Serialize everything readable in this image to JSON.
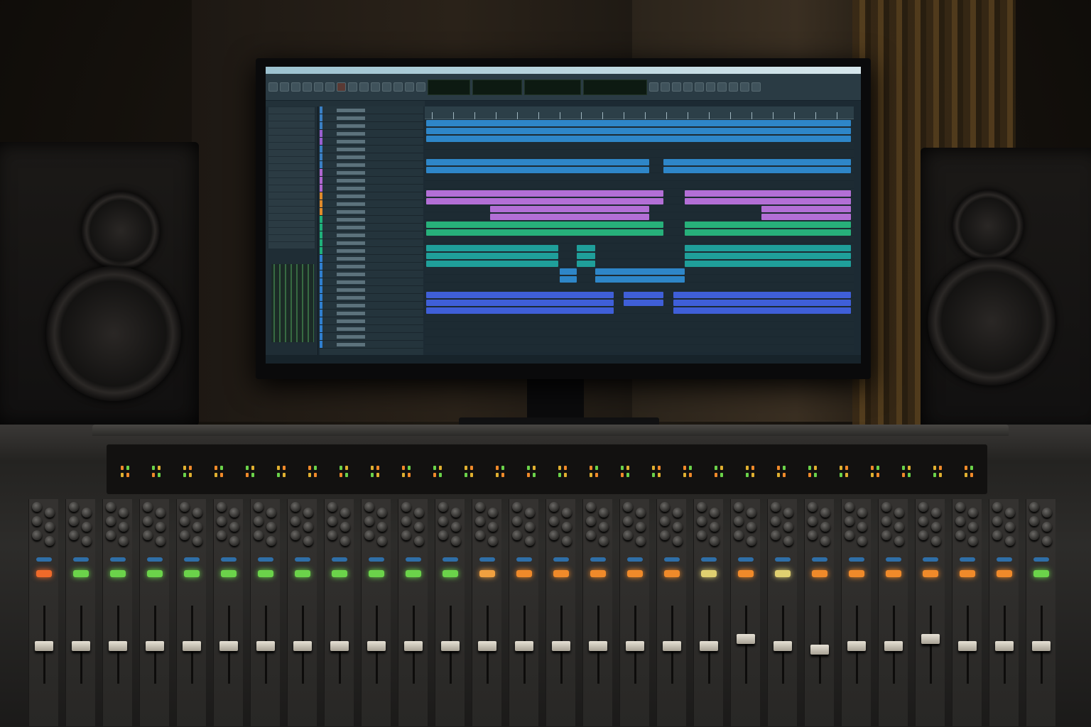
{
  "scene": {
    "description_free": true
  },
  "colors": {
    "clip_blue": "#2e86c8",
    "clip_purple": "#b36fd6",
    "clip_green": "#27b07a",
    "clip_teal": "#1f9f9a",
    "clip_indigo": "#3f5fd8",
    "lcd_green": "#5fe06f",
    "led_orange": "#f08a2a",
    "led_green": "#6bd34a",
    "fader_cap": "#e7e2d6"
  },
  "daw": {
    "track_colors": [
      "#3a7fc4",
      "#3a7fc4",
      "#3a7fc4",
      "#9a5fd0",
      "#9a5fd0",
      "#3a7fc4",
      "#3a7fc4",
      "#3a7fc4",
      "#b066d0",
      "#b066d0",
      "#b066d0",
      "#e08a2a",
      "#e08a2a",
      "#e08a2a",
      "#1fb07a",
      "#1fb07a",
      "#1fb07a",
      "#1fb07a",
      "#1fb07a",
      "#2f7fcf",
      "#2f7fcf",
      "#2f7fcf",
      "#2f7fcf",
      "#2f7fcf",
      "#2f7fcf",
      "#2f7fcf",
      "#2f7fcf",
      "#2f7fcf",
      "#2f7fcf",
      "#2f7fcf",
      "#2f7fcf"
    ]
  },
  "console": {
    "channel_count": 28,
    "button_colors": [
      "#f06a2a",
      "#6bd34a",
      "#6bd34a",
      "#6bd34a",
      "#6bd34a",
      "#6bd34a",
      "#6bd34a",
      "#6bd34a",
      "#6bd34a",
      "#6bd34a",
      "#6bd34a",
      "#6bd34a",
      "#f0a040",
      "#f08a2a",
      "#f08a2a",
      "#f08a2a",
      "#f08a2a",
      "#f08a2a",
      "#e0d070",
      "#f08a2a",
      "#e0d070",
      "#f08a2a",
      "#f08a2a",
      "#f08a2a",
      "#f08a2a",
      "#f08a2a",
      "#f08a2a",
      "#6bd34a"
    ],
    "fader_levels": [
      0.5,
      0.5,
      0.5,
      0.5,
      0.5,
      0.5,
      0.5,
      0.5,
      0.5,
      0.5,
      0.5,
      0.5,
      0.5,
      0.5,
      0.5,
      0.5,
      0.5,
      0.5,
      0.5,
      0.6,
      0.5,
      0.45,
      0.5,
      0.5,
      0.6,
      0.5,
      0.5,
      0.5
    ]
  }
}
